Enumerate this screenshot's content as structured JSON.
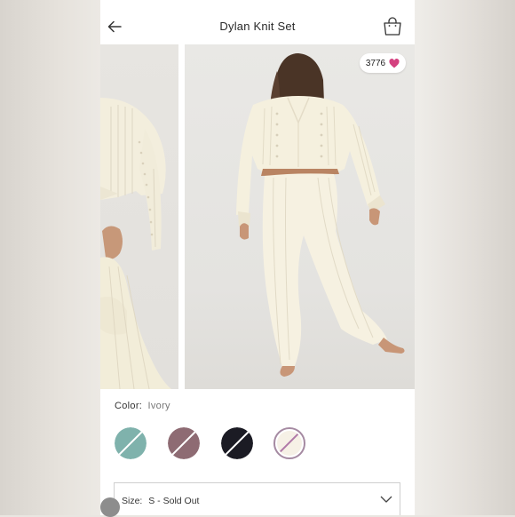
{
  "header": {
    "title": "Dylan Knit Set",
    "back_icon": "arrow-left-icon",
    "bag_icon": "shopping-bag-icon"
  },
  "gallery": {
    "likes": "3776",
    "like_icon": "heart-icon",
    "like_color": "#d4407f",
    "garment_color": "#f4efdf"
  },
  "color_selector": {
    "label": "Color:",
    "value": "Ivory",
    "swatches": [
      {
        "name": "teal",
        "color": "#7fb2ac",
        "sold_out": true,
        "selected": false
      },
      {
        "name": "mauve",
        "color": "#8e6b73",
        "sold_out": true,
        "selected": false
      },
      {
        "name": "black",
        "color": "#1b1b24",
        "sold_out": true,
        "selected": false
      },
      {
        "name": "ivory",
        "color": "#f6f1e6",
        "sold_out": true,
        "selected": true
      }
    ]
  },
  "size_selector": {
    "label": "Size:",
    "value": "S - Sold Out",
    "chevron_icon": "chevron-down-icon"
  }
}
